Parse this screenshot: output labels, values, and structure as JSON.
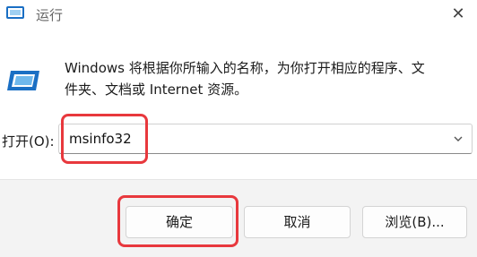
{
  "window": {
    "title": "运行",
    "close_glyph": "✕",
    "icon": "run-icon"
  },
  "content": {
    "icon": "run-app-icon",
    "description_line1": "Windows 将根据你所输入的名称，为你打开相应的程序、文",
    "description_line2": "件夹、文档或 Internet 资源。"
  },
  "open": {
    "label": "打开(O):",
    "value": "msinfo32",
    "dropdown_icon": "chevron-down-icon"
  },
  "buttons": {
    "ok": "确定",
    "cancel": "取消",
    "browse": "浏览(B)..."
  },
  "colors": {
    "highlight": "#e8383d",
    "icon_blue": "#1a6fc4"
  }
}
